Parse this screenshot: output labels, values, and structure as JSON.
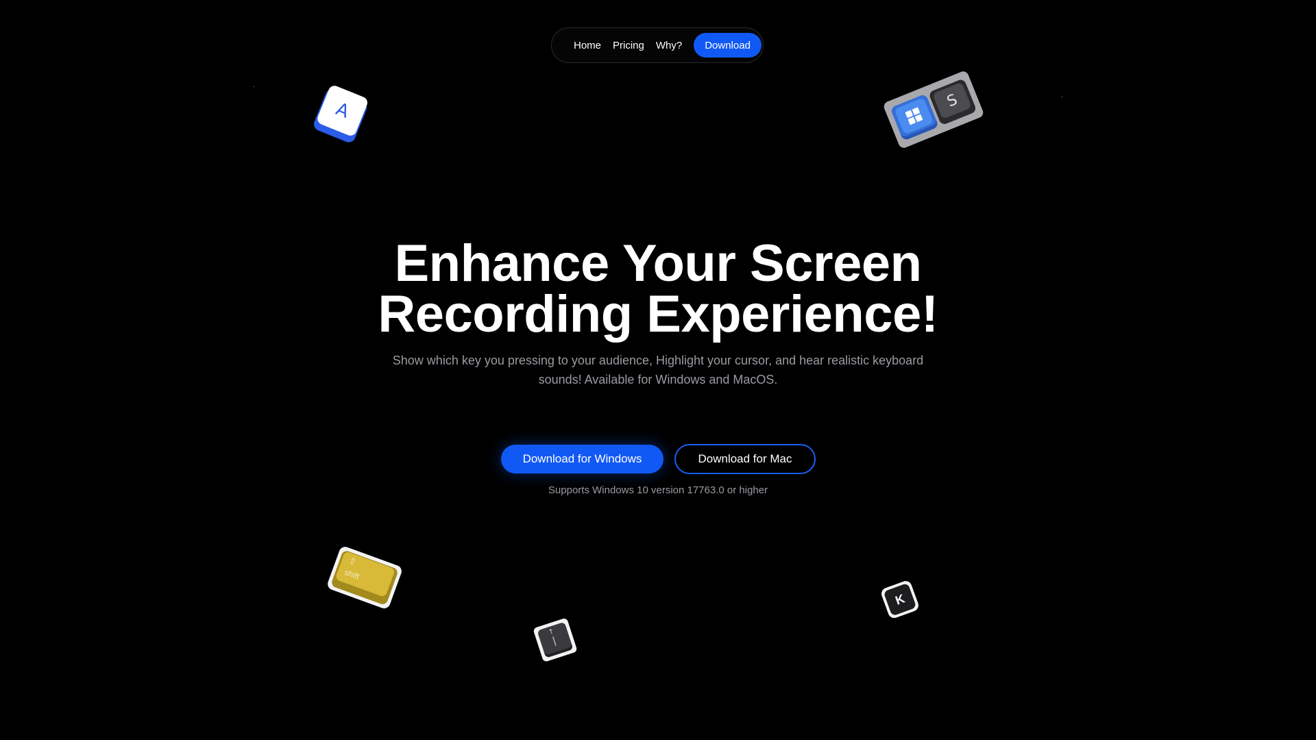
{
  "nav": {
    "links": [
      {
        "label": "Home"
      },
      {
        "label": "Pricing"
      },
      {
        "label": "Why?"
      }
    ],
    "cta_label": "Download"
  },
  "hero": {
    "title_line1": "Enhance Your Screen",
    "title_line2": "Recording Experience!",
    "subtitle": "Show which key you pressing to your audience, Highlight your cursor, and hear realistic keyboard sounds! Available for Windows and MacOS.",
    "primary_button": "Download for Windows",
    "secondary_button": "Download for Mac",
    "support_note": "Supports Windows 10 version 17763.0 or higher"
  },
  "keycaps": {
    "a": "A",
    "s": "S",
    "shift_arrow": "⇧",
    "shift_label": "shift",
    "pipe_arrow": "↑",
    "pipe_bar": "|",
    "k": "K"
  },
  "colors": {
    "background": "#000000",
    "accent": "#1159f5",
    "muted_text": "#9b9ba3",
    "shift_key": "#d8b938",
    "key_a_accent": "#2a5de8"
  }
}
